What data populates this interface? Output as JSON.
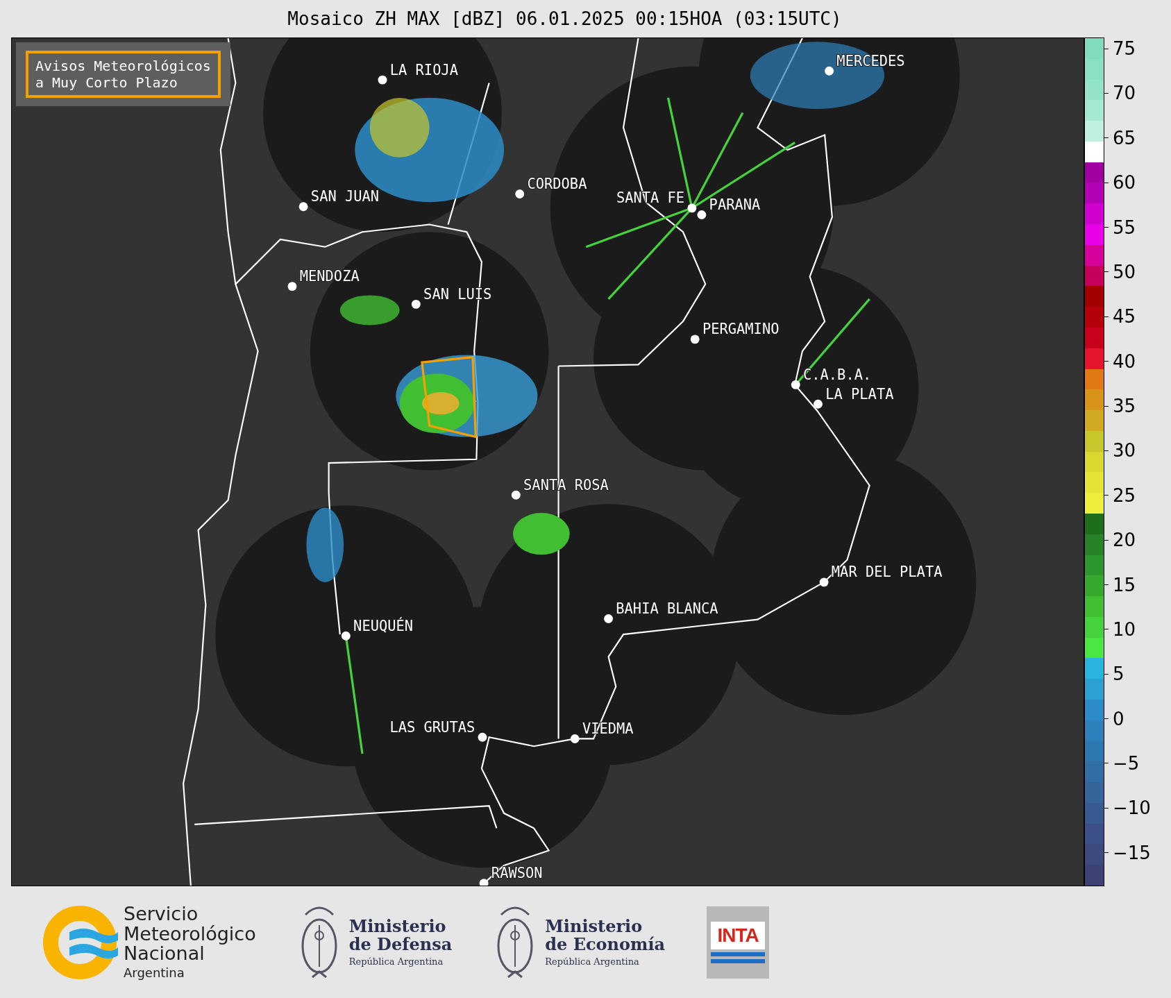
{
  "title": "Mosaico ZH MAX [dBZ] 06.01.2025 00:15HOA (03:15UTC)",
  "legend_box": {
    "text": "Avisos Meteorológicos\na Muy Corto Plazo"
  },
  "cities": [
    {
      "name": "LA RIOJA"
    },
    {
      "name": "MERCEDES"
    },
    {
      "name": "CORDOBA"
    },
    {
      "name": "SAN JUAN"
    },
    {
      "name": "SANTA FE"
    },
    {
      "name": "PARANA"
    },
    {
      "name": "MENDOZA"
    },
    {
      "name": "SAN LUIS"
    },
    {
      "name": "PERGAMINO"
    },
    {
      "name": "C.A.B.A."
    },
    {
      "name": "LA PLATA"
    },
    {
      "name": "SANTA ROSA"
    },
    {
      "name": "MAR DEL PLATA"
    },
    {
      "name": "BAHIA BLANCA"
    },
    {
      "name": "NEUQUÉN"
    },
    {
      "name": "LAS GRUTAS"
    },
    {
      "name": "VIEDMA"
    },
    {
      "name": "RAWSON"
    }
  ],
  "colorbar": {
    "ticks": [
      "75",
      "70",
      "65",
      "60",
      "55",
      "50",
      "45",
      "40",
      "35",
      "30",
      "25",
      "20",
      "15",
      "10",
      "5",
      "0",
      "−5",
      "−10",
      "−15"
    ],
    "bands": [
      {
        "color": "#80dcbb"
      },
      {
        "color": "#89e0c2"
      },
      {
        "color": "#94e3c8"
      },
      {
        "color": "#a6e9d2"
      },
      {
        "color": "#c0f0de"
      },
      {
        "color": "#ffffff"
      },
      {
        "color": "#a000a0"
      },
      {
        "color": "#b400b4"
      },
      {
        "color": "#d000d0"
      },
      {
        "color": "#e800e8"
      },
      {
        "color": "#d6009a"
      },
      {
        "color": "#c4005a"
      },
      {
        "color": "#a00000"
      },
      {
        "color": "#b40008"
      },
      {
        "color": "#c8001e"
      },
      {
        "color": "#e6142d"
      },
      {
        "color": "#e07814"
      },
      {
        "color": "#d8941a"
      },
      {
        "color": "#d0aa22"
      },
      {
        "color": "#c8c82d"
      },
      {
        "color": "#d8d830"
      },
      {
        "color": "#e4e436"
      },
      {
        "color": "#eeee3c"
      },
      {
        "color": "#1e6e1e"
      },
      {
        "color": "#288228"
      },
      {
        "color": "#2e962e"
      },
      {
        "color": "#37aa2d"
      },
      {
        "color": "#41be32"
      },
      {
        "color": "#46d23c"
      },
      {
        "color": "#4be641"
      },
      {
        "color": "#28b4dc"
      },
      {
        "color": "#2da0d2"
      },
      {
        "color": "#2d8cc8"
      },
      {
        "color": "#2d80b9"
      },
      {
        "color": "#2d78af"
      },
      {
        "color": "#326ea5"
      },
      {
        "color": "#36649b"
      },
      {
        "color": "#375a91"
      },
      {
        "color": "#3c5087"
      },
      {
        "color": "#3c4a7d"
      },
      {
        "color": "#3c4273"
      }
    ]
  },
  "logos": [
    {
      "kind": "smn",
      "name": "Servicio\nMeteorológico\nNacional",
      "subtitle": "Argentina"
    },
    {
      "kind": "ministry",
      "name": "Ministerio\nde Defensa",
      "subtitle": "República Argentina"
    },
    {
      "kind": "ministry",
      "name": "Ministerio\nde Economía",
      "subtitle": "República Argentina"
    },
    {
      "kind": "inta",
      "name": "INTA"
    }
  ]
}
